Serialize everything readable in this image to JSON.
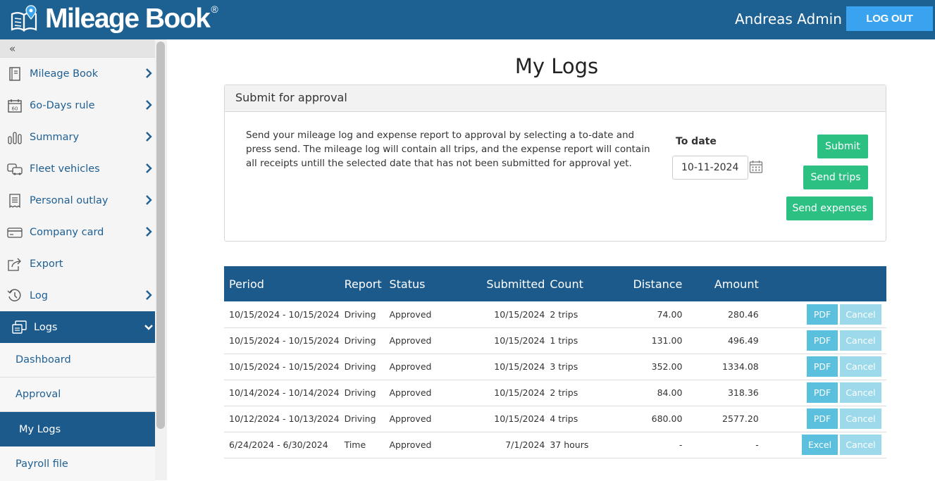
{
  "header": {
    "logo_text": "Mileage Book",
    "logo_reg": "®",
    "user_name": "Andreas Admin",
    "logout_label": "LOG OUT"
  },
  "sidebar": {
    "collapse_glyph": "«",
    "items": [
      {
        "label": "Mileage Book",
        "icon": "book-icon"
      },
      {
        "label": "6o-Days rule",
        "icon": "calendar-60-icon"
      },
      {
        "label": "Summary",
        "icon": "bar-chart-icon"
      },
      {
        "label": "Fleet vehicles",
        "icon": "vehicles-icon"
      },
      {
        "label": "Personal outlay",
        "icon": "receipt-icon"
      },
      {
        "label": "Company card",
        "icon": "credit-card-icon"
      },
      {
        "label": "Export",
        "icon": "export-icon"
      },
      {
        "label": "Log",
        "icon": "history-icon"
      },
      {
        "label": "Logs",
        "icon": "logs-icon"
      }
    ],
    "sub_items": [
      {
        "label": "Dashboard"
      },
      {
        "label": "Approval"
      },
      {
        "label": "My Logs"
      },
      {
        "label": "Payroll file"
      }
    ]
  },
  "main": {
    "title": "My Logs",
    "panel": {
      "heading": "Submit for approval",
      "text": "Send your mileage log and expense report to approval by selecting a to-date and press send. The mileage log will contain all trips, and the expense report will contain all receipts untill the selected date that has not been submitted for approval yet.",
      "to_date_label": "To date",
      "to_date_value": "10-11-2024",
      "submit_label": "Submit",
      "send_trips_label": "Send trips",
      "send_expenses_label": "Send expenses"
    },
    "table": {
      "headers": [
        "Period",
        "Report",
        "Status",
        "Submitted",
        "Count",
        "Distance",
        "Amount"
      ],
      "rows": [
        {
          "period": "10/15/2024 - 10/15/2024",
          "report": "Driving",
          "status": "Approved",
          "submitted": "10/15/2024",
          "count": "2 trips",
          "distance": "74.00",
          "amount": "280.46",
          "file_btn": "PDF",
          "cancel_btn": "Cancel"
        },
        {
          "period": "10/15/2024 - 10/15/2024",
          "report": "Driving",
          "status": "Approved",
          "submitted": "10/15/2024",
          "count": "1 trips",
          "distance": "131.00",
          "amount": "496.49",
          "file_btn": "PDF",
          "cancel_btn": "Cancel"
        },
        {
          "period": "10/15/2024 - 10/15/2024",
          "report": "Driving",
          "status": "Approved",
          "submitted": "10/15/2024",
          "count": "3 trips",
          "distance": "352.00",
          "amount": "1334.08",
          "file_btn": "PDF",
          "cancel_btn": "Cancel"
        },
        {
          "period": "10/14/2024 - 10/14/2024",
          "report": "Driving",
          "status": "Approved",
          "submitted": "10/15/2024",
          "count": "2 trips",
          "distance": "84.00",
          "amount": "318.36",
          "file_btn": "PDF",
          "cancel_btn": "Cancel"
        },
        {
          "period": "10/12/2024 - 10/13/2024",
          "report": "Driving",
          "status": "Approved",
          "submitted": "10/15/2024",
          "count": "4 trips",
          "distance": "680.00",
          "amount": "2577.20",
          "file_btn": "PDF",
          "cancel_btn": "Cancel"
        },
        {
          "period": "6/24/2024 - 6/30/2024",
          "report": "Time",
          "status": "Approved",
          "submitted": "7/1/2024",
          "count": "37 hours",
          "distance": "-",
          "amount": "-",
          "file_btn": "Excel",
          "cancel_btn": "Cancel"
        }
      ]
    }
  },
  "colors": {
    "header_bg": "#1d6193",
    "logout_bg": "#3aa3f0",
    "nav_active_bg": "#1d5a8c",
    "nav_text": "#1f5f92",
    "green_btn": "#2cc183",
    "pdf_btn": "#5bc0de",
    "cancel_btn": "#9cd9ea"
  }
}
